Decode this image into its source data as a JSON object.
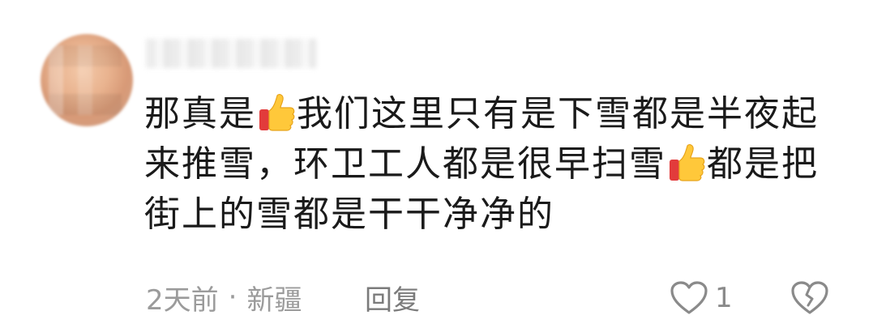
{
  "comment": {
    "content_line1_a": "那真是",
    "content_line1_b": "我们这里只有是下雪都是半夜起",
    "content_line2_a": "来推雪，环卫工人都是很早扫雪",
    "content_line2_b": "都是把",
    "content_line3": "街上的雪都是干干净净的",
    "emoji_icon": "thumbs-up-emoji",
    "time": "2天前",
    "separator": "·",
    "location": "新疆",
    "reply_label": "回复",
    "like_count": "1",
    "like_icon": "heart-outline-icon",
    "dislike_icon": "broken-heart-icon"
  }
}
